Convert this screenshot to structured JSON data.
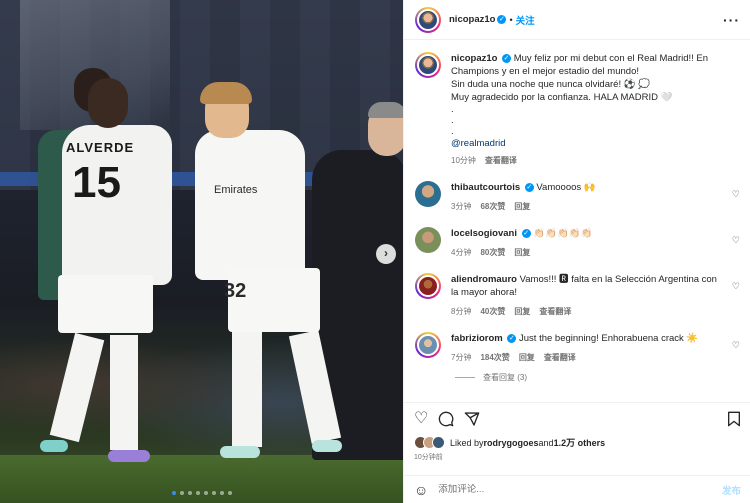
{
  "photo": {
    "alt": "",
    "player_name_on_shirt": "ALVERDE",
    "player_number_on_shirt": "15",
    "sponsor_on_shirt": "Emirates",
    "number_on_shorts": "32",
    "carousel_next_glyph": "›",
    "carousel_dots": 8
  },
  "header": {
    "username": "nicopaz1o",
    "separator": "•",
    "follow_label": "关注",
    "more_glyph": "···"
  },
  "caption": {
    "username": "nicopaz1o",
    "lines": [
      "Muy feliz por mi debut con el Real Madrid!! En",
      "Champions y en el mejor estadio del mundo!",
      "Sin duda una noche que nunca olvidaré! ⚽ 💭",
      "Muy agradecido por la confianza. HALA MADRID 🤍"
    ],
    "dots": [
      ".",
      ".",
      "."
    ],
    "mention": "@realmadrid",
    "time": "10分钟",
    "translate": "查看翻译"
  },
  "comments": [
    {
      "username": "thibautcourtois",
      "text": "Vamoooos 🙌",
      "time": "3分钟",
      "likes": "68次赞",
      "reply": "回复",
      "translate": ""
    },
    {
      "username": "locelsogiovani",
      "text": "👏🏻👏🏻👏🏻👏🏻👏🏻",
      "time": "4分钟",
      "likes": "80次赞",
      "reply": "回复",
      "translate": ""
    },
    {
      "username": "aliendromauro",
      "text": "Vamos!!! 🆁 falta en la Selección Argentina con la mayor ahora!",
      "time": "8分钟",
      "likes": "40次赞",
      "reply": "回复",
      "translate": "查看翻译"
    },
    {
      "username": "fabriziorom",
      "text": "Just the beginning! Enhorabuena crack ☀️",
      "time": "7分钟",
      "likes": "184次赞",
      "reply": "回复",
      "translate": "查看翻译"
    }
  ],
  "view_replies": "查看回复 (3)",
  "actions": {
    "like_icon": "heart-icon",
    "comment_icon": "comment-icon",
    "share_icon": "share-icon",
    "save_icon": "bookmark-icon"
  },
  "likes": {
    "prefix": "Liked by ",
    "user": "rodrygogoes",
    "and": " and ",
    "others": "1.2万 others"
  },
  "post_time": "10分钟前",
  "composer": {
    "placeholder": "添加评论...",
    "post_label": "发布"
  },
  "colors": {
    "accent": "#0095f6",
    "text": "#262626",
    "muted": "#737373"
  }
}
